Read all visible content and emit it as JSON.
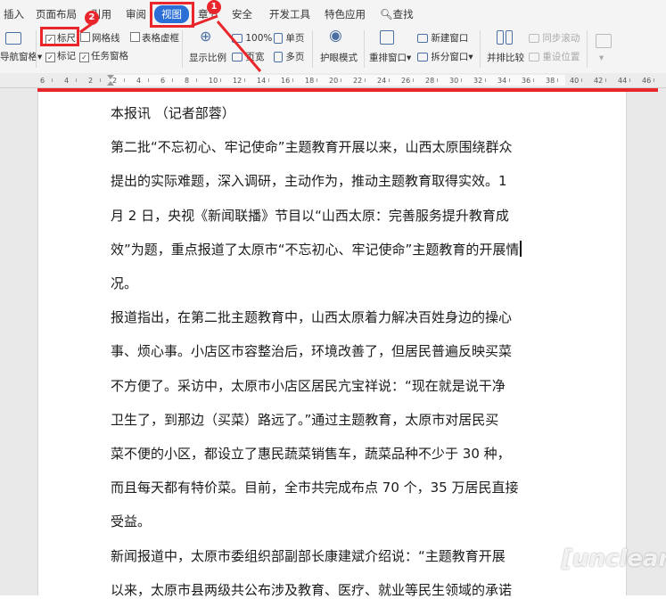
{
  "tabs": [
    "插入",
    "页面布局",
    "引用",
    "审阅",
    "视图",
    "章节",
    "安全",
    "开发工具",
    "特色应用",
    "查找"
  ],
  "ribbon": {
    "nav_pane": "导航窗格",
    "ruler": "标尺",
    "gridlines": "网格线",
    "table_borders": "表格虚框",
    "markup": "标记",
    "task_pane": "任务窗格",
    "zoom_ratio": "显示比例",
    "zoom_100": "100%",
    "page_width": "页宽",
    "single_page": "单页",
    "multi_page": "多页",
    "eye_mode": "护眼模式",
    "rearrange": "重排窗口",
    "new_window": "新建窗口",
    "split_window": "拆分窗口",
    "side_by_side": "并排比较",
    "sync_scroll": "同步滚动",
    "reset_position": "重设位置"
  },
  "ruler_labels": [
    "6",
    "4",
    "2",
    "2",
    "4",
    "6",
    "8",
    "10",
    "12",
    "14",
    "16",
    "18",
    "20",
    "22",
    "24",
    "26",
    "28",
    "30",
    "32",
    "34",
    "36",
    "38",
    "40",
    "42",
    "44",
    "46"
  ],
  "badges": [
    "1",
    "2"
  ],
  "document": {
    "lines": [
      "本报讯 （记者部蓉）",
      "第二批“不忘初心、牢记使命”主题教育开展以来，山西太原围绕群众",
      "提出的实际难题，深入调研，主动作为，推动主题教育取得实效。1",
      "月 2 日，央视《新闻联播》节目以“山西太原：完善服务提升教育成",
      "效”为题，重点报道了太原市“不忘初心、牢记使命”主题教育的开展情",
      "况。",
      "报道指出，在第二批主题教育中，山西太原着力解决百姓身边的操心",
      "事、烦心事。小店区市容整治后，环境改善了，但居民普遍反映买菜",
      "不方便了。采访中，太原市小店区居民亢宝祥说：“现在就是说干净",
      "卫生了，到那边（买菜）路远了。”通过主题教育，太原市对居民买",
      "菜不便的小区，都设立了惠民蔬菜销售车，蔬菜品种不少于 30 种，",
      "而且每天都有特价菜。目前，全市共完成布点 70 个，35 万居民直接",
      "受益。",
      "新闻报道中，太原市委组织部副部长康建斌介绍说：“主题教育开展",
      "以来，太原市县两级共公布涉及教育、医疗、就业等民生领域的承诺"
    ]
  },
  "watermark": "[unclear]"
}
